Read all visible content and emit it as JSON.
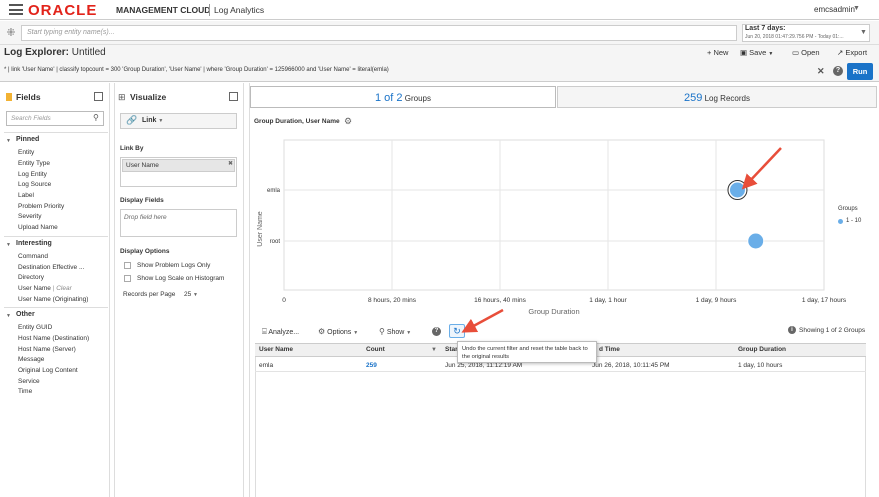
{
  "header": {
    "logo": "ORACLE",
    "product": "MANAGEMENT CLOUD",
    "app": "Log Analytics",
    "user": "emcsadmin"
  },
  "entity_bar": {
    "placeholder": "Start typing entity name(s)...",
    "time_label": "Last 7 days:",
    "time_range": "Jun 20, 2018 01:47:29.756 PM - Today 01:..."
  },
  "title_bar": {
    "title_bold": "Log Explorer:",
    "title": "Untitled",
    "new": "New",
    "save": "Save",
    "open": "Open",
    "export": "Export"
  },
  "query": {
    "text": "* | link 'User Name' | classify topcount = 300 'Group Duration', 'User Name' | where 'Group Duration' = 125966000 and 'User Name' = literal(emla)",
    "run": "Run"
  },
  "fields": {
    "title": "Fields",
    "search_placeholder": "Search Fields",
    "pinned_label": "Pinned",
    "pinned": [
      "Entity",
      "Entity Type",
      "Log Entity",
      "Log Source",
      "Label",
      "Problem Priority",
      "Severity",
      "Upload Name"
    ],
    "interesting_label": "Interesting",
    "interesting": [
      "Command",
      "Destination Effective ...",
      "Directory",
      "User Name",
      "User Name (Originating)"
    ],
    "user_name_clear": "Clear",
    "other_label": "Other",
    "other": [
      "Entity GUID",
      "Host Name (Destination)",
      "Host Name (Server)",
      "Message",
      "Original Log Content",
      "Service",
      "Time"
    ]
  },
  "visualize": {
    "title": "Visualize",
    "type": "Link",
    "link_by_label": "Link By",
    "link_by_chip": "User Name",
    "display_fields_label": "Display Fields",
    "drop_placeholder": "Drop field here",
    "display_options_label": "Display Options",
    "opt_problem_logs": "Show Problem Logs Only",
    "opt_log_scale": "Show Log Scale on Histogram",
    "records_per_page_label": "Records per Page",
    "records_per_page": "25"
  },
  "tabs": {
    "groups_num": "1 of 2",
    "groups_label": "Groups",
    "records_num": "259",
    "records_label": "Log Records"
  },
  "chart_data": {
    "type": "scatter",
    "title": "Group Duration, User Name",
    "xlabel": "Group Duration",
    "ylabel": "User Name",
    "x_ticks": [
      "0",
      "8 hours, 20 mins",
      "16 hours, 40 mins",
      "1 day, 1 hour",
      "1 day, 9 hours",
      "1 day, 17 hours"
    ],
    "y_categories": [
      "emla",
      "root"
    ],
    "points": [
      {
        "y": "emla",
        "x_hours": 34.99,
        "selected": true
      },
      {
        "y": "root",
        "x_hours": 36.4,
        "selected": false
      }
    ],
    "legend_title": "Groups",
    "legend_item": "1 - 10",
    "point_color": "#6aaee8"
  },
  "toolbar": {
    "analyze": "Analyze...",
    "options": "Options",
    "show": "Show",
    "tooltip": "Undo the current filter and reset the table back to the original results",
    "showing": "Showing 1 of 2 Groups"
  },
  "table": {
    "headers": [
      "User Name",
      "Count",
      "Start Time",
      "End Time",
      "Group Duration"
    ],
    "header_start_visible": "Star",
    "header_end_visible": "d Time",
    "rows": [
      {
        "user": "emla",
        "count": "259",
        "start": "Jun 25, 2018, 11:12:19 AM",
        "end": "Jun 26, 2018, 10:11:45 PM",
        "duration": "1 day, 10 hours"
      }
    ]
  }
}
